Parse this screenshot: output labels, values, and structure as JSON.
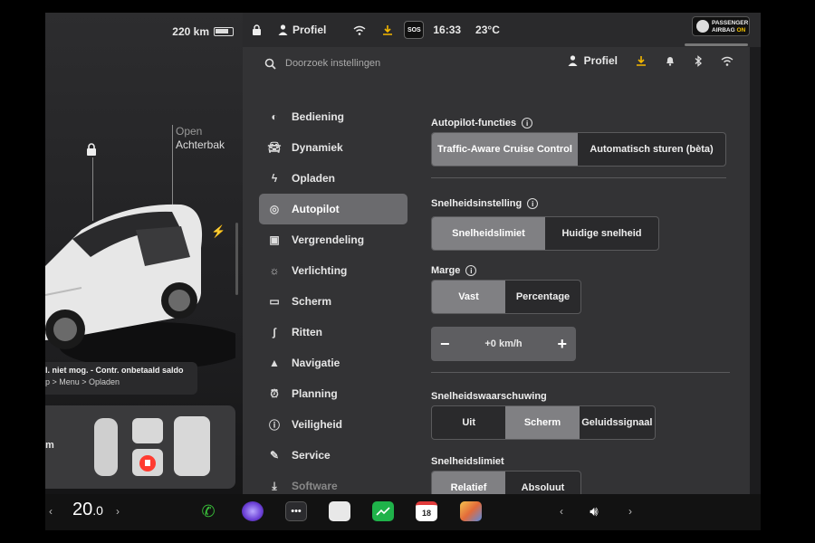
{
  "left_pane": {
    "range": "220 km",
    "trunk_open": "Open",
    "trunk_label": "Achterbak",
    "notice_line1": "l. niet mog. - Contr. onbetaald saldo",
    "notice_line2": "p > Menu > Opladen",
    "seat_card_label": "m"
  },
  "statusbar": {
    "profile": "Profiel",
    "time": "16:33",
    "temperature": "23°C",
    "sos": "SOS",
    "airbag_line1": "PASSENGER",
    "airbag_line2": "AIRBAG",
    "airbag_state": "ON"
  },
  "search": {
    "placeholder": "Doorzoek instellingen",
    "profile": "Profiel"
  },
  "menu": [
    {
      "label": "Bediening",
      "icon": "toggle-icon"
    },
    {
      "label": "Dynamiek",
      "icon": "car-icon"
    },
    {
      "label": "Opladen",
      "icon": "bolt-icon"
    },
    {
      "label": "Autopilot",
      "icon": "steering-wheel-icon",
      "active": true
    },
    {
      "label": "Vergrendeling",
      "icon": "lock-icon"
    },
    {
      "label": "Verlichting",
      "icon": "sun-icon"
    },
    {
      "label": "Scherm",
      "icon": "display-icon"
    },
    {
      "label": "Ritten",
      "icon": "trips-icon"
    },
    {
      "label": "Navigatie",
      "icon": "navigation-icon"
    },
    {
      "label": "Planning",
      "icon": "alarm-icon"
    },
    {
      "label": "Veiligheid",
      "icon": "alert-icon"
    },
    {
      "label": "Service",
      "icon": "wrench-icon"
    },
    {
      "label": "Software",
      "icon": "download-icon"
    }
  ],
  "autopilot": {
    "functions_title": "Autopilot-functies",
    "functions_options": [
      "Traffic-Aware Cruise Control",
      "Automatisch sturen (bèta)"
    ],
    "functions_selected": "Traffic-Aware Cruise Control",
    "speed_setting_title": "Snelheidsinstelling",
    "speed_setting_options": [
      "Snelheidslimiet",
      "Huidige snelheid"
    ],
    "speed_setting_selected": "Snelheidslimiet",
    "margin_title": "Marge",
    "margin_options": [
      "Vast",
      "Percentage"
    ],
    "margin_selected": "Vast",
    "offset_value": "+0 km/h",
    "minus": "−",
    "plus": "+",
    "warning_title": "Snelheidswaarschuwing",
    "warning_options": [
      "Uit",
      "Scherm",
      "Geluidssignaal"
    ],
    "warning_selected": "Scherm",
    "limit_title": "Snelheidslimiet",
    "limit_options": [
      "Relatief",
      "Absoluut"
    ],
    "limit_selected": "Relatief"
  },
  "taskbar": {
    "temp_int": "20",
    "temp_dec": ".0",
    "calendar_day": "18",
    "chevron_left": "‹",
    "chevron_right": "›"
  },
  "colors": {
    "download_icon": "#f5b800",
    "phone_icon": "#3ac23a",
    "sentry_icon": "#ff3b30"
  }
}
